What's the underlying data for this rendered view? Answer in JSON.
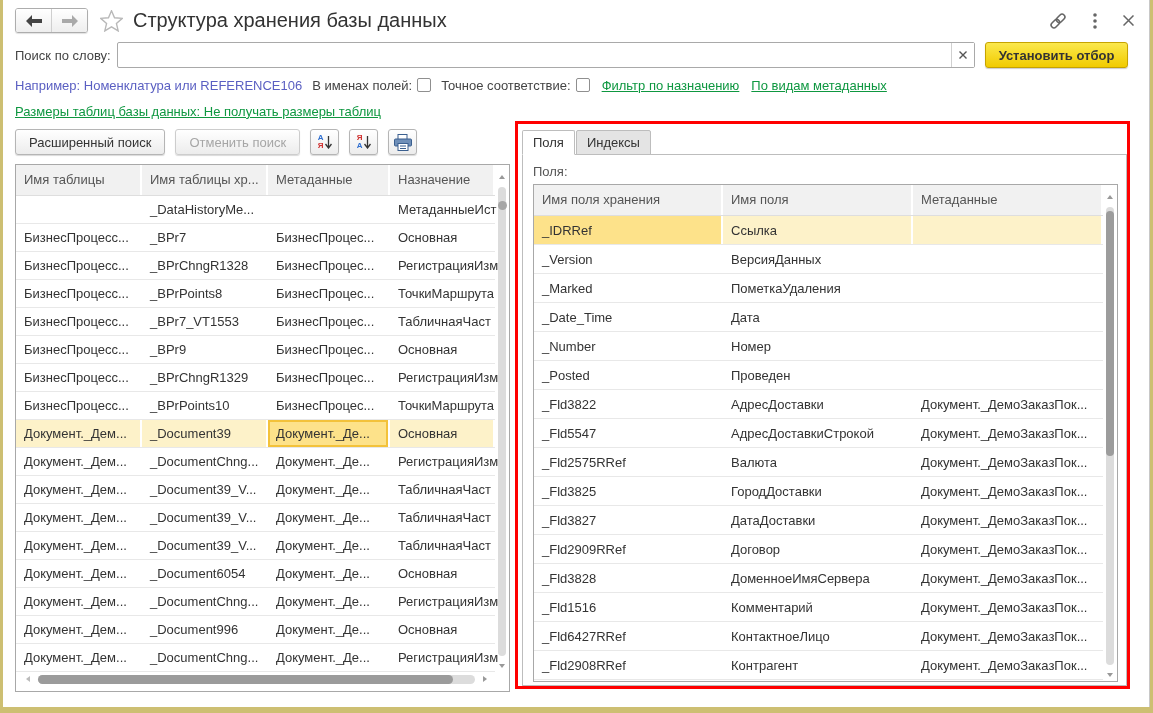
{
  "window": {
    "title": "Структура хранения базы данных"
  },
  "navigation": [
    {
      "kind": "back",
      "disabled": false
    },
    {
      "kind": "forward",
      "disabled": true
    }
  ],
  "search": {
    "label": "Поиск по слову:"
  },
  "apply_button": "Установить отбор",
  "hint": "Например: Номенклатура или REFERENCE106",
  "options": [
    {
      "label": "В именах полей:",
      "checked": false
    },
    {
      "label": "Точное соответствие:",
      "checked": false
    }
  ],
  "links": [
    "Фильтр по назначению",
    "По видам метаданных"
  ],
  "sizes_link": "Размеры таблиц базы данных: Не получать размеры таблиц",
  "toolbar": [
    {
      "kind": "text",
      "label": "Расширенный поиск",
      "disabled": false
    },
    {
      "kind": "text",
      "label": "Отменить поиск",
      "disabled": true
    },
    {
      "kind": "sort",
      "disabled": false,
      "letters": [
        {
          "text": "А",
          "color": "#2f6fd0"
        },
        {
          "text": "Я",
          "color": "#d0302f"
        }
      ]
    },
    {
      "kind": "sort",
      "disabled": false,
      "letters": [
        {
          "text": "Я",
          "color": "#d0302f"
        },
        {
          "text": "А",
          "color": "#2f6fd0"
        }
      ]
    },
    {
      "kind": "print",
      "disabled": false
    }
  ],
  "tables_grid": {
    "columns": [
      {
        "title": "Имя таблицы",
        "current": false
      },
      {
        "title": "Имя таблицы хр...",
        "current": false
      },
      {
        "title": "Метаданные",
        "current": true
      },
      {
        "title": "Назначение",
        "current": false
      }
    ],
    "rows": [
      {
        "storage_name": "_DataHistoryMe...",
        "purpose": "МетаданныеИст",
        "selected": false
      },
      {
        "table_name": "БизнесПроцесс...",
        "storage_name": "_BPr7",
        "metadata": "БизнесПроцес...",
        "purpose": "Основная",
        "selected": false
      },
      {
        "table_name": "БизнесПроцесс...",
        "storage_name": "_BPrChngR1328",
        "metadata": "БизнесПроцес...",
        "purpose": "РегистрацияИзм",
        "selected": false
      },
      {
        "table_name": "БизнесПроцесс...",
        "storage_name": "_BPrPoints8",
        "metadata": "БизнесПроцес...",
        "purpose": "ТочкиМаршрута",
        "selected": false
      },
      {
        "table_name": "БизнесПроцесс...",
        "storage_name": "_BPr7_VT1553",
        "metadata": "БизнесПроцес...",
        "purpose": "ТабличнаяЧаст",
        "selected": false
      },
      {
        "table_name": "БизнесПроцесс...",
        "storage_name": "_BPr9",
        "metadata": "БизнесПроцес...",
        "purpose": "Основная",
        "selected": false
      },
      {
        "table_name": "БизнесПроцесс...",
        "storage_name": "_BPrChngR1329",
        "metadata": "БизнесПроцес...",
        "purpose": "РегистрацияИзм",
        "selected": false
      },
      {
        "table_name": "БизнесПроцесс...",
        "storage_name": "_BPrPoints10",
        "metadata": "БизнесПроцес...",
        "purpose": "ТочкиМаршрута",
        "selected": false
      },
      {
        "table_name": "Документ._Дем...",
        "storage_name": "_Document39",
        "metadata": "Документ._Де...",
        "purpose": "Основная",
        "selected": true
      },
      {
        "table_name": "Документ._Дем...",
        "storage_name": "_DocumentChng...",
        "metadata": "Документ._Де...",
        "purpose": "РегистрацияИзм",
        "selected": false
      },
      {
        "table_name": "Документ._Дем...",
        "storage_name": "_Document39_V...",
        "metadata": "Документ._Де...",
        "purpose": "ТабличнаяЧаст",
        "selected": false
      },
      {
        "table_name": "Документ._Дем...",
        "storage_name": "_Document39_V...",
        "metadata": "Документ._Де...",
        "purpose": "ТабличнаяЧаст",
        "selected": false
      },
      {
        "table_name": "Документ._Дем...",
        "storage_name": "_Document39_V...",
        "metadata": "Документ._Де...",
        "purpose": "ТабличнаяЧаст",
        "selected": false
      },
      {
        "table_name": "Документ._Дем...",
        "storage_name": "_Document6054",
        "metadata": "Документ._Де...",
        "purpose": "Основная",
        "selected": false
      },
      {
        "table_name": "Документ._Дем...",
        "storage_name": "_DocumentChng...",
        "metadata": "Документ._Де...",
        "purpose": "РегистрацияИзм",
        "selected": false
      },
      {
        "table_name": "Документ._Дем...",
        "storage_name": "_Document996",
        "metadata": "Документ._Де...",
        "purpose": "Основная",
        "selected": false
      },
      {
        "table_name": "Документ._Дем...",
        "storage_name": "_DocumentChng...",
        "metadata": "Документ._Де...",
        "purpose": "РегистрацияИзм",
        "selected": false
      }
    ]
  },
  "details": {
    "tabs": [
      {
        "label": "Поля",
        "selected": true
      },
      {
        "label": "Индексы",
        "selected": false
      }
    ],
    "fields_label": "Поля:",
    "fields_grid": {
      "columns": [
        {
          "title": "Имя поля хранения",
          "current": true
        },
        {
          "title": "Имя поля",
          "current": false
        },
        {
          "title": "Метаданные",
          "current": false
        }
      ],
      "rows": [
        {
          "storage_name": "_IDRRef",
          "field_name": "Ссылка",
          "selected": true
        },
        {
          "storage_name": "_Version",
          "field_name": "ВерсияДанных",
          "selected": false
        },
        {
          "storage_name": "_Marked",
          "field_name": "ПометкаУдаления",
          "selected": false
        },
        {
          "storage_name": "_Date_Time",
          "field_name": "Дата",
          "selected": false
        },
        {
          "storage_name": "_Number",
          "field_name": "Номер",
          "selected": false
        },
        {
          "storage_name": "_Posted",
          "field_name": "Проведен",
          "selected": false
        },
        {
          "storage_name": "_Fld3822",
          "field_name": "АдресДоставки",
          "metadata": "Документ._ДемоЗаказПок...",
          "selected": false
        },
        {
          "storage_name": "_Fld5547",
          "field_name": "АдресДоставкиСтрокой",
          "metadata": "Документ._ДемоЗаказПок...",
          "selected": false
        },
        {
          "storage_name": "_Fld2575RRef",
          "field_name": "Валюта",
          "metadata": "Документ._ДемоЗаказПок...",
          "selected": false
        },
        {
          "storage_name": "_Fld3825",
          "field_name": "ГородДоставки",
          "metadata": "Документ._ДемоЗаказПок...",
          "selected": false
        },
        {
          "storage_name": "_Fld3827",
          "field_name": "ДатаДоставки",
          "metadata": "Документ._ДемоЗаказПок...",
          "selected": false
        },
        {
          "storage_name": "_Fld2909RRef",
          "field_name": "Договор",
          "metadata": "Документ._ДемоЗаказПок...",
          "selected": false
        },
        {
          "storage_name": "_Fld3828",
          "field_name": "ДоменноеИмяСервера",
          "metadata": "Документ._ДемоЗаказПок...",
          "selected": false
        },
        {
          "storage_name": "_Fld1516",
          "field_name": "Комментарий",
          "metadata": "Документ._ДемоЗаказПок...",
          "selected": false
        },
        {
          "storage_name": "_Fld6427RRef",
          "field_name": "КонтактноеЛицо",
          "metadata": "Документ._ДемоЗаказПок...",
          "selected": false
        },
        {
          "storage_name": "_Fld2908RRef",
          "field_name": "Контрагент",
          "metadata": "Документ._ДемоЗаказПок...",
          "selected": false
        }
      ]
    }
  }
}
